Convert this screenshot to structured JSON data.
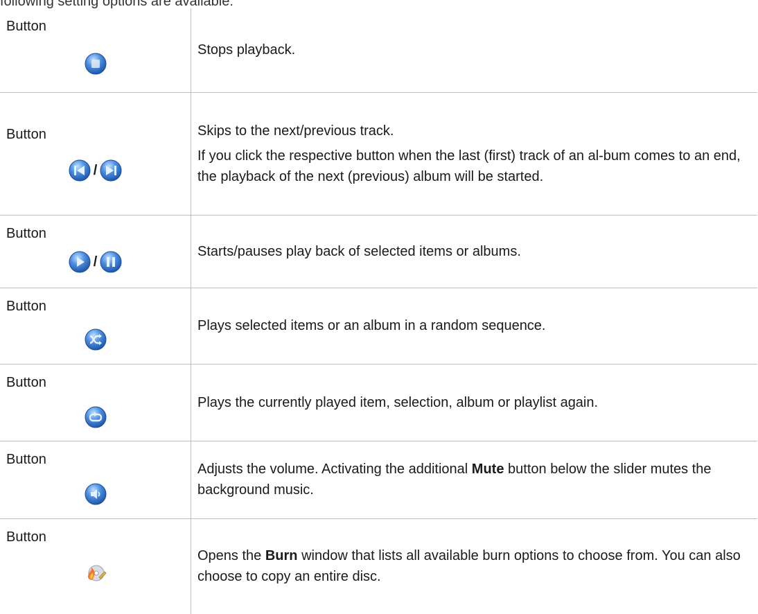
{
  "clipped_intro": "following setting options are available:",
  "rows": [
    {
      "label": "Button",
      "icons": [
        "stop-icon"
      ],
      "separator": "",
      "desc": [
        "Stops playback."
      ]
    },
    {
      "label": "Button",
      "icons": [
        "previous-track-icon",
        "next-track-icon"
      ],
      "separator": "/",
      "desc": [
        "Skips to the next/previous track.",
        "If you click the respective button when the last (first) track of an al-bum comes to an end, the playback of the next (previous) album will be started."
      ]
    },
    {
      "label": "Button",
      "icons": [
        "play-icon",
        "pause-icon"
      ],
      "separator": "/",
      "desc": [
        "Starts/pauses play back of selected items or albums."
      ]
    },
    {
      "label": "Button",
      "icons": [
        "shuffle-icon"
      ],
      "separator": "",
      "desc": [
        "Plays selected items or an album in a random sequence."
      ]
    },
    {
      "label": "Button",
      "icons": [
        "repeat-icon"
      ],
      "separator": "",
      "desc": [
        "Plays the currently played item, selection, album or playlist again."
      ]
    },
    {
      "label": "Button",
      "icons": [
        "volume-icon"
      ],
      "separator": "",
      "desc_pre": "Adjusts the volume. Activating the additional ",
      "desc_bold": "Mute",
      "desc_post": " button below the slider mutes the background music."
    },
    {
      "label": "Button",
      "icons": [
        "burn-icon"
      ],
      "separator": "",
      "desc_pre": "Opens the ",
      "desc_bold": "Burn",
      "desc_post": " window that lists all available burn options to choose from. You can also choose to copy an entire disc."
    }
  ],
  "colors": {
    "icon_blue_light": "#7fb3e8",
    "icon_blue_dark": "#1f5fae",
    "grid": "#bfbfbf"
  }
}
